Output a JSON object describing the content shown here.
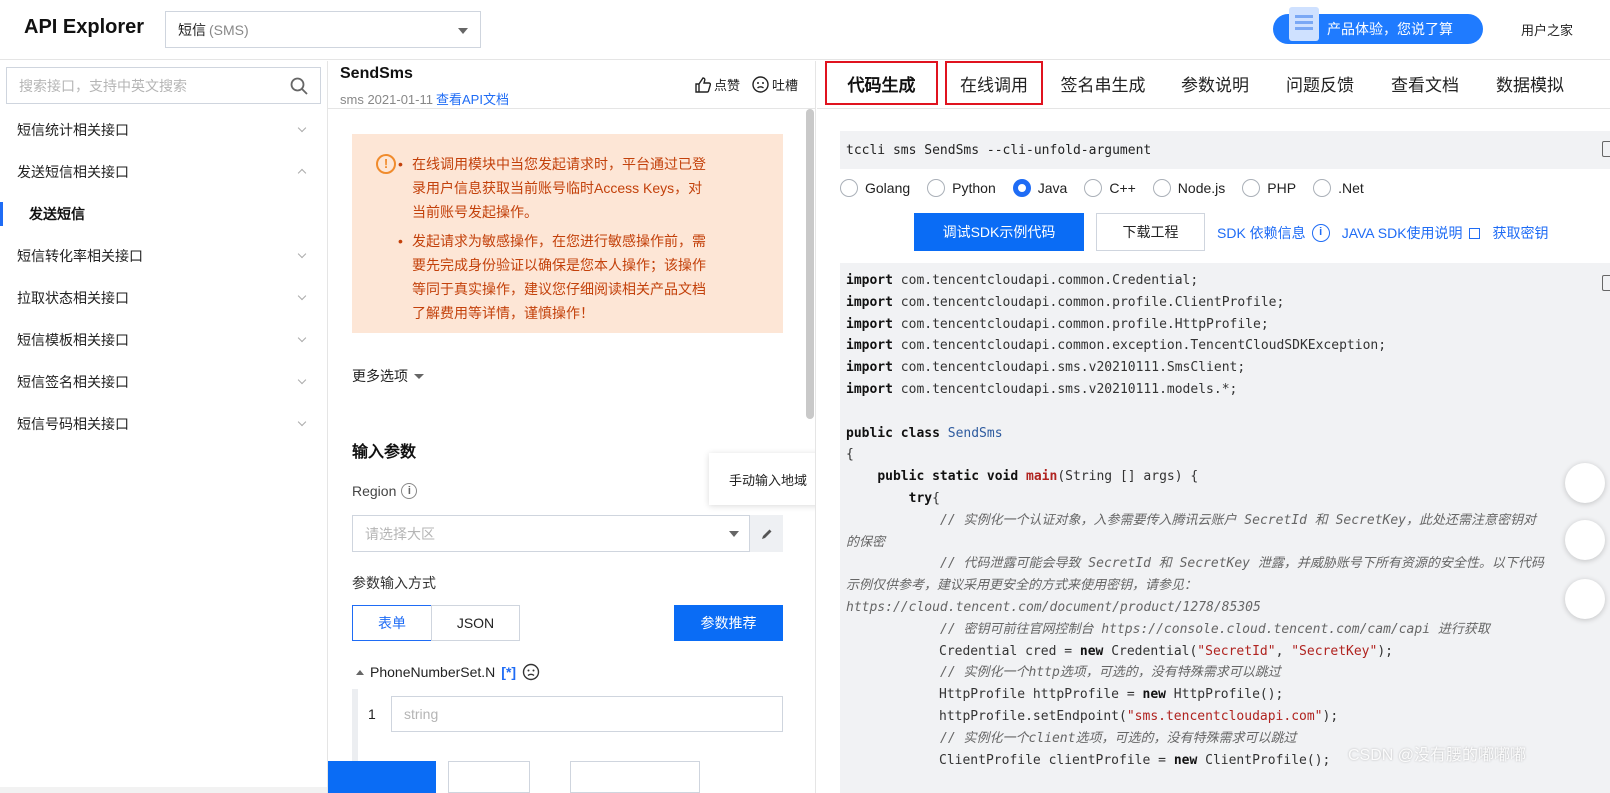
{
  "header": {
    "brand": "API Explorer",
    "product_name": "短信",
    "product_code": "(SMS)",
    "survey_label": "产品体验，您说了算",
    "user_text": "用户之家"
  },
  "sidebar": {
    "search_placeholder": "搜索接口，支持中英文搜索",
    "items": [
      {
        "label": "短信统计相关接口"
      },
      {
        "label": "发送短信相关接口"
      },
      {
        "label": "发送短信"
      },
      {
        "label": "短信转化率相关接口"
      },
      {
        "label": "拉取状态相关接口"
      },
      {
        "label": "短信模板相关接口"
      },
      {
        "label": "短信签名相关接口"
      },
      {
        "label": "短信号码相关接口"
      }
    ]
  },
  "middle": {
    "api_name": "SendSms",
    "api_meta": "sms 2021-01-11",
    "doc_link": "查看API文档",
    "like_label": "点赞",
    "complain_label": "吐槽",
    "warnings": [
      "在线调用模块中当您发起请求时，平台通过已登录用户信息获取当前账号临时Access Keys，对当前账号发起操作。",
      "发起请求为敏感操作，在您进行敏感操作前，需要先完成身份验证以确保是您本人操作；该操作等同于真实操作，建议您仔细阅读相关产品文档了解费用等详情，谨慎操作！"
    ],
    "more_options": "更多选项",
    "section_title": "输入参数",
    "region_label": "Region",
    "region_tooltip": "手动输入地域",
    "region_placeholder": "请选择大区",
    "input_mode_label": "参数输入方式",
    "mode_form": "表单",
    "mode_json": "JSON",
    "recommend_button": "参数推荐",
    "param_name": "PhoneNumberSet.N",
    "param_required": "[*]",
    "param_index": "1",
    "param_placeholder": "string"
  },
  "right": {
    "tabs": [
      {
        "label": "代码生成"
      },
      {
        "label": "在线调用"
      },
      {
        "label": "签名串生成"
      },
      {
        "label": "参数说明"
      },
      {
        "label": "问题反馈"
      },
      {
        "label": "查看文档"
      },
      {
        "label": "数据模拟"
      }
    ],
    "cli_command": "tccli sms SendSms --cli-unfold-argument",
    "languages": [
      {
        "label": "Golang",
        "checked": false
      },
      {
        "label": "Python",
        "checked": false
      },
      {
        "label": "Java",
        "checked": true
      },
      {
        "label": "C++",
        "checked": false
      },
      {
        "label": "Node.js",
        "checked": false
      },
      {
        "label": "PHP",
        "checked": false
      },
      {
        "label": ".Net",
        "checked": false
      }
    ],
    "debug_button": "调试SDK示例代码",
    "download_button": "下载工程",
    "sdk_dep_link": "SDK 依赖信息",
    "java_sdk_link": "JAVA SDK使用说明",
    "get_key_link": "获取密钥",
    "code": {
      "imports": [
        {
          "kw": "import",
          "rest": " com.tencentcloudapi.common.Credential;"
        },
        {
          "kw": "import",
          "rest": " com.tencentcloudapi.common.profile.ClientProfile;"
        },
        {
          "kw": "import",
          "rest": " com.tencentcloudapi.common.profile.HttpProfile;"
        },
        {
          "kw": "import",
          "rest": " com.tencentcloudapi.common.exception.TencentCloudSDKException;"
        },
        {
          "kw": "import",
          "rest": " com.tencentcloudapi.sms.v20210111.SmsClient;"
        },
        {
          "kw": "import",
          "rest": " com.tencentcloudapi.sms.v20210111.models.*;"
        }
      ],
      "class_kw": "public class",
      "class_name": "SendSms",
      "open_brace": "{",
      "main_kw": "public static void",
      "main_name": "main",
      "main_args": "(String [] args) {",
      "try_kw": "try",
      "try_brace": "{",
      "comment1": "// 实例化一个认证对象，入参需要传入腾讯云账户 SecretId 和 SecretKey，此处还需注意密钥对的保密",
      "comment2": "// 代码泄露可能会导致 SecretId 和 SecretKey 泄露，并威胁账号下所有资源的安全性。以下代码示例仅供参考，建议采用更安全的方式来使用密钥，请参见：https://cloud.tencent.com/document/product/1278/85305",
      "comment3": "// 密钥可前往官网控制台 https://console.cloud.tencent.com/cam/capi 进行获取",
      "cred_a": "Credential cred = ",
      "cred_new": "new",
      "cred_b": " Credential(",
      "cred_s1": "\"SecretId\"",
      "cred_c": ", ",
      "cred_s2": "\"SecretKey\"",
      "cred_d": ");",
      "comment4": "// 实例化一个http选项，可选的，没有特殊需求可以跳过",
      "http_a": "HttpProfile httpProfile = ",
      "http_new": "new",
      "http_b": " HttpProfile();",
      "ep_a": "httpProfile.setEndpoint(",
      "ep_s": "\"sms.tencentcloudapi.com\"",
      "ep_b": ");",
      "comment5": "// 实例化一个client选项，可选的，没有特殊需求可以跳过",
      "cp_a": "ClientProfile clientProfile = ",
      "cp_new": "new",
      "cp_b": " ClientProfile();"
    }
  },
  "watermark": "CSDN @没有腰的嘟嘟嘟",
  "colors": {
    "primary": "#0a6cf5",
    "warning_bg": "#fde6d6",
    "warning_text": "#c3410b",
    "highlight_box": "#e0131f"
  }
}
